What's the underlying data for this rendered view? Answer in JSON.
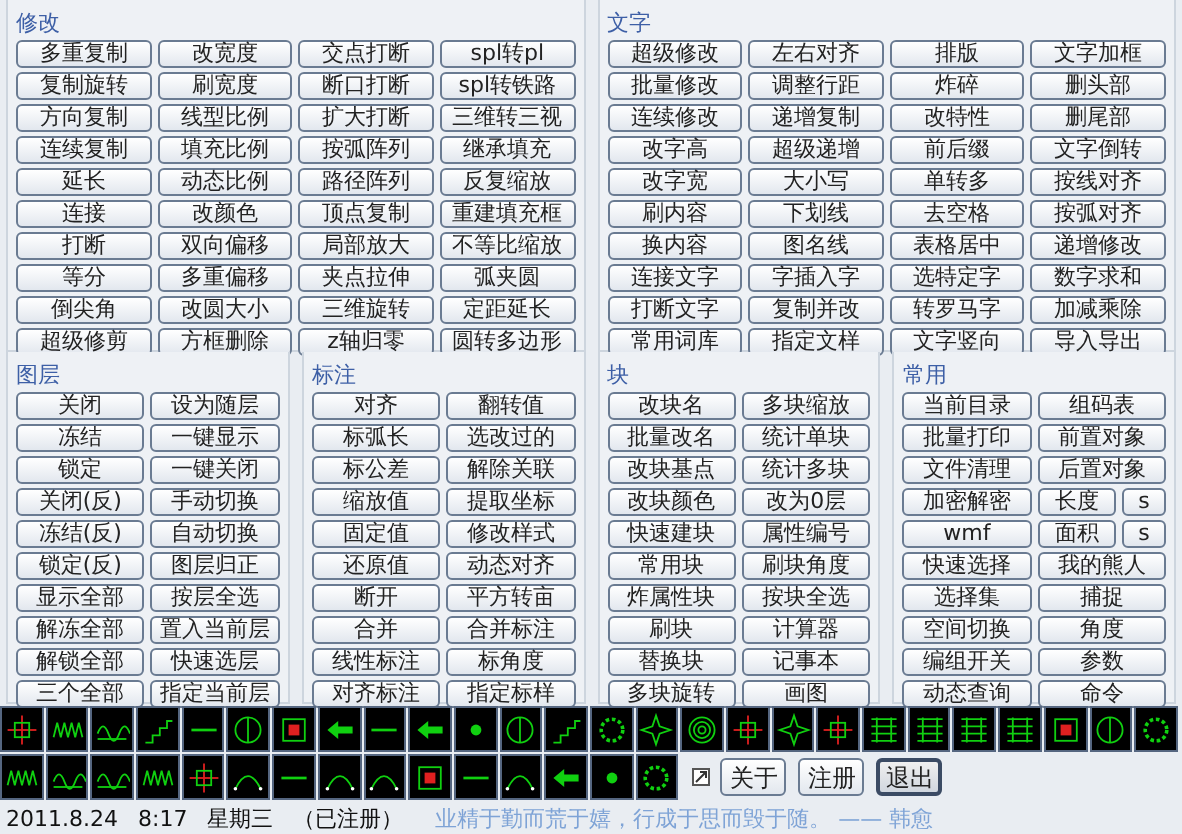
{
  "sections": [
    {
      "title": "修改",
      "rows": [
        [
          "多重复制",
          "改宽度",
          "交点打断",
          "spl转pl"
        ],
        [
          "复制旋转",
          "刷宽度",
          "断口打断",
          "spl转铁路"
        ],
        [
          "方向复制",
          "线型比例",
          "扩大打断",
          "三维转三视"
        ],
        [
          "连续复制",
          "填充比例",
          "按弧阵列",
          "继承填充"
        ],
        [
          "延长",
          "动态比例",
          "路径阵列",
          "反复缩放"
        ],
        [
          "连接",
          "改颜色",
          "顶点复制",
          "重建填充框"
        ],
        [
          "打断",
          "双向偏移",
          "局部放大",
          "不等比缩放"
        ],
        [
          "等分",
          "多重偏移",
          "夹点拉伸",
          "弧夹圆"
        ],
        [
          "倒尖角",
          "改圆大小",
          "三维旋转",
          "定距延长"
        ],
        [
          "超级修剪",
          "方框删除",
          "z轴归零",
          "圆转多边形"
        ]
      ]
    },
    {
      "title": "文字",
      "rows": [
        [
          "超级修改",
          "左右对齐",
          "排版",
          "文字加框"
        ],
        [
          "批量修改",
          "调整行距",
          "炸碎",
          "删头部"
        ],
        [
          "连续修改",
          "递增复制",
          "改特性",
          "删尾部"
        ],
        [
          "改字高",
          "超级递增",
          "前后缀",
          "文字倒转"
        ],
        [
          "改字宽",
          "大小写",
          "单转多",
          "按线对齐"
        ],
        [
          "刷内容",
          "下划线",
          "去空格",
          "按弧对齐"
        ],
        [
          "换内容",
          "图名线",
          "表格居中",
          "递增修改"
        ],
        [
          "连接文字",
          "字插入字",
          "选特定字",
          "数字求和"
        ],
        [
          "打断文字",
          "复制并改",
          "转罗马字",
          "加减乘除"
        ],
        [
          "常用词库",
          "指定文样",
          "文字竖向",
          "导入导出"
        ]
      ]
    },
    {
      "title": "图层",
      "rows": [
        [
          "关闭",
          "设为随层"
        ],
        [
          "冻结",
          "一键显示"
        ],
        [
          "锁定",
          "一键关闭"
        ],
        [
          "关闭(反)",
          "手动切换"
        ],
        [
          "冻结(反)",
          "自动切换"
        ],
        [
          "锁定(反)",
          "图层归正"
        ],
        [
          "显示全部",
          "按层全选"
        ],
        [
          "解冻全部",
          "置入当前层"
        ],
        [
          "解锁全部",
          "快速选层"
        ],
        [
          "三个全部",
          "指定当前层"
        ]
      ]
    },
    {
      "title": "标注",
      "rows": [
        [
          "对齐",
          "翻转值"
        ],
        [
          "标弧长",
          "选改过的"
        ],
        [
          "标公差",
          "解除关联"
        ],
        [
          "缩放值",
          "提取坐标"
        ],
        [
          "固定值",
          "修改样式"
        ],
        [
          "还原值",
          "动态对齐"
        ],
        [
          "断开",
          "平方转亩"
        ],
        [
          "合并",
          "合并标注"
        ],
        [
          "线性标注",
          "标角度"
        ],
        [
          "对齐标注",
          "指定标样"
        ]
      ]
    },
    {
      "title": "块",
      "rows": [
        [
          "改块名",
          "多块缩放"
        ],
        [
          "批量改名",
          "统计单块"
        ],
        [
          "改块基点",
          "统计多块"
        ],
        [
          "改块颜色",
          "改为0层"
        ],
        [
          "快速建块",
          "属性编号"
        ],
        [
          "常用块",
          "刷块角度"
        ],
        [
          "炸属性块",
          "按块全选"
        ],
        [
          "刷块",
          "计算器"
        ],
        [
          "替换块",
          "记事本"
        ],
        [
          "多块旋转",
          "画图"
        ]
      ]
    },
    {
      "title": "常用",
      "rows": [
        [
          "当前目录",
          "组码表"
        ],
        [
          "批量打印",
          "前置对象"
        ],
        [
          "文件清理",
          "后置对象"
        ],
        [
          "加密解密",
          [
            "长度",
            "s"
          ]
        ],
        [
          "wmf",
          [
            "面积",
            "s"
          ]
        ],
        [
          "快速选择",
          "我的熊人"
        ],
        [
          "选择集",
          "捕捉"
        ],
        [
          "空间切换",
          "角度"
        ],
        [
          "编组开关",
          "参数"
        ],
        [
          "动态查询",
          "命令"
        ]
      ]
    }
  ],
  "bottom_buttons": [
    {
      "label": "关于",
      "focused": false
    },
    {
      "label": "注册",
      "focused": false
    },
    {
      "label": "退出",
      "focused": true
    }
  ],
  "status_bar": {
    "date": "2011.8.24",
    "time": "8:17",
    "weekday": "星期三",
    "registration": "（已注册）",
    "motto": "业精于勤而荒于嬉，行成于思而毁于随。 —— 韩愈"
  }
}
